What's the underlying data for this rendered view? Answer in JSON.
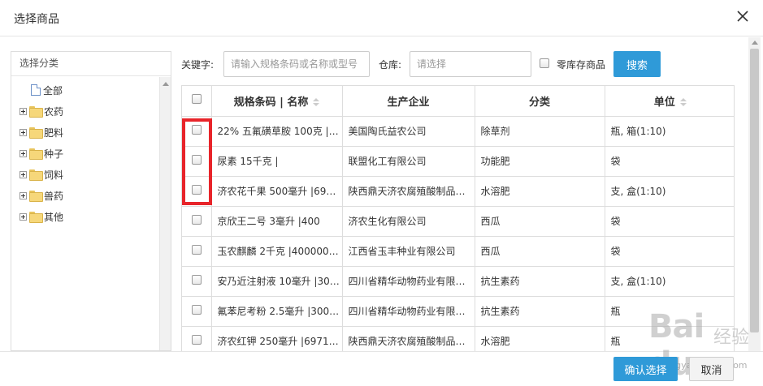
{
  "dialog": {
    "title": "选择商品"
  },
  "category_panel": {
    "title": "选择分类",
    "items": [
      {
        "label": "全部",
        "type": "doc"
      },
      {
        "label": "农药",
        "type": "folder"
      },
      {
        "label": "肥料",
        "type": "folder"
      },
      {
        "label": "种子",
        "type": "folder"
      },
      {
        "label": "饲料",
        "type": "folder"
      },
      {
        "label": "兽药",
        "type": "folder"
      },
      {
        "label": "其他",
        "type": "folder"
      }
    ]
  },
  "search": {
    "keyword_label": "关键字:",
    "keyword_placeholder": "请输入规格条码或名称或型号",
    "warehouse_label": "仓库:",
    "warehouse_placeholder": "请选择",
    "zero_stock_label": "零库存商品",
    "search_button": "搜索"
  },
  "table": {
    "headers": [
      "规格条码 | 名称",
      "生产企业",
      "分类",
      "单位"
    ],
    "rows": [
      [
        "22% 五氟磺草胺 100克 |2…",
        "美国陶氏益农公司",
        "除草剂",
        "瓶, 箱(1:10)"
      ],
      [
        "尿素 15千克 |",
        "联盟化工有限公司",
        "功能肥",
        "袋"
      ],
      [
        "济农花千果 500毫升 |697…",
        "陕西鼎天济农腐殖酸制品…",
        "水溶肥",
        "支, 盒(1:10)"
      ],
      [
        "京欣王二号 3毫升 |400",
        "济农生化有限公司",
        "西瓜",
        "袋"
      ],
      [
        "玉农麒麟 2千克 |4000000…",
        "江西省玉丰种业有限公司",
        "西瓜",
        "袋"
      ],
      [
        "安乃近注射液 10毫升 |30…",
        "四川省精华动物药业有限…",
        "抗生素药",
        "支, 盒(1:10)"
      ],
      [
        "氟苯尼考粉 2.5毫升 |300…",
        "四川省精华动物药业有限…",
        "抗生素药",
        "瓶"
      ],
      [
        "济农红钾 250毫升 |69712…",
        "陕西鼎天济农腐殖酸制品…",
        "水溶肥",
        "瓶"
      ]
    ]
  },
  "footer": {
    "confirm_button": "确认选择",
    "cancel_button": "取消"
  },
  "watermark": {
    "logo": "Bai du",
    "logo_cn": "经验",
    "url": "jingyan.baidu.com"
  },
  "colors": {
    "primary": "#2f9ad8",
    "highlight": "#e8242a"
  }
}
